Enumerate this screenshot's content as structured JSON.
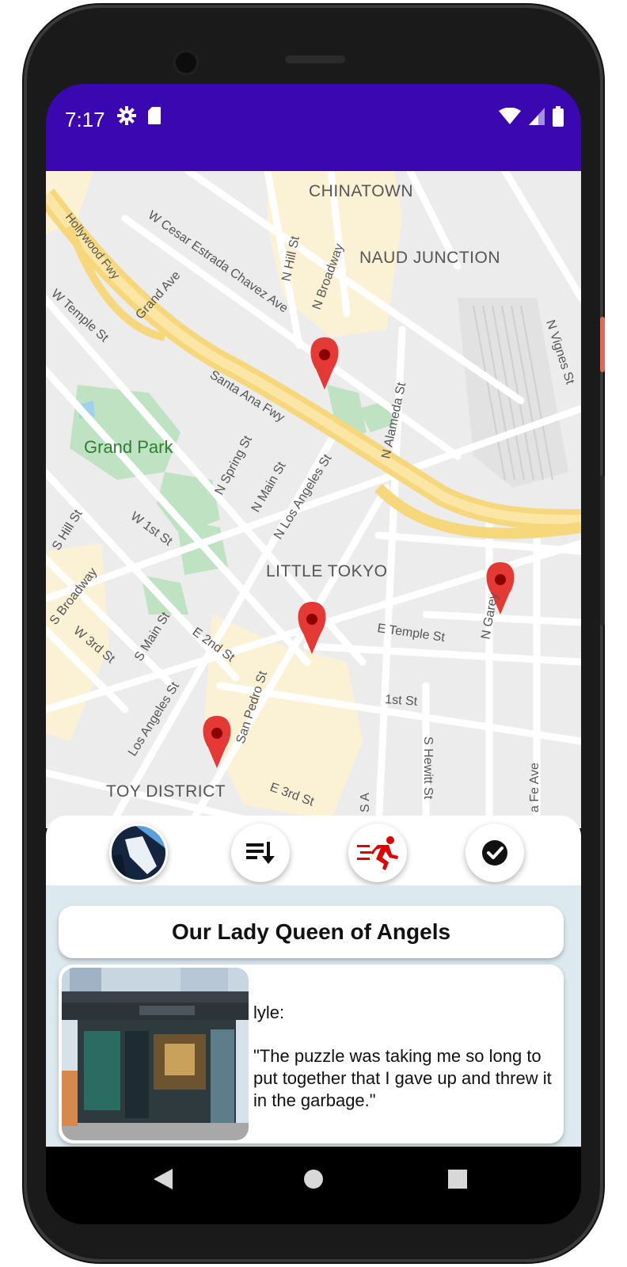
{
  "status_bar": {
    "time": "7:17",
    "bg_color": "#3a07b0",
    "icons_left": [
      "settings-icon",
      "sd-card-icon"
    ],
    "icons_right": [
      "wifi-icon",
      "cell-signal-icon",
      "battery-icon"
    ]
  },
  "map": {
    "labels": {
      "chinatown": "CHINATOWN",
      "naud_junction": "NAUD JUNCTION",
      "little_tokyo": "LITTLE TOKYO",
      "toy_district": "TOY DISTRICT",
      "grand_park": "Grand Park",
      "hollywood_fwy": "Hollywood Fwy",
      "w_cesar": "W Cesar Estrada Chavez Ave",
      "grand_ave": "Grand Ave",
      "n_hill": "N Hill St",
      "n_broadway": "N Broadway",
      "w_temple": "W Temple St",
      "santa_ana": "Santa Ana Fwy",
      "n_alameda": "N Alameda St",
      "n_vignes": "N Vignes St",
      "n_spring": "N Spring St",
      "n_main": "N Main St",
      "n_los_angeles": "N Los Angeles St",
      "s_hill": "S Hill St",
      "w_1st": "W 1st St",
      "s_broadway": "S Broadway",
      "w_3rd": "W 3rd St",
      "s_main": "S Main St",
      "e_2nd": "E 2nd St",
      "e_temple": "E Temple St",
      "n_garey": "N Garey",
      "first_st": "1st St",
      "s_hewitt": "S Hewitt St",
      "los_angeles_st": "Los Angeles St",
      "san_pedro": "San Pedro St",
      "e_3rd": "E 3rd St",
      "santa_fe": "a Fe Ave",
      "s_a": "S A"
    },
    "marker_color": "#e53935"
  },
  "toolbar": {
    "buttons": [
      {
        "name": "avatar-button",
        "icon": "avatar-icon"
      },
      {
        "name": "sort-button",
        "icon": "sort-down-icon"
      },
      {
        "name": "run-button",
        "icon": "running-person-icon",
        "color": "#e00000"
      },
      {
        "name": "check-button",
        "icon": "check-circle-icon"
      }
    ]
  },
  "location": {
    "title": "Our Lady Queen of Angels",
    "user": "lyle:",
    "quote": "\"The puzzle was taking me so long to put together that I gave up and threw it in the garbage.\""
  },
  "nav_bar": {
    "icons": [
      "back-icon",
      "home-icon",
      "recents-icon"
    ]
  }
}
